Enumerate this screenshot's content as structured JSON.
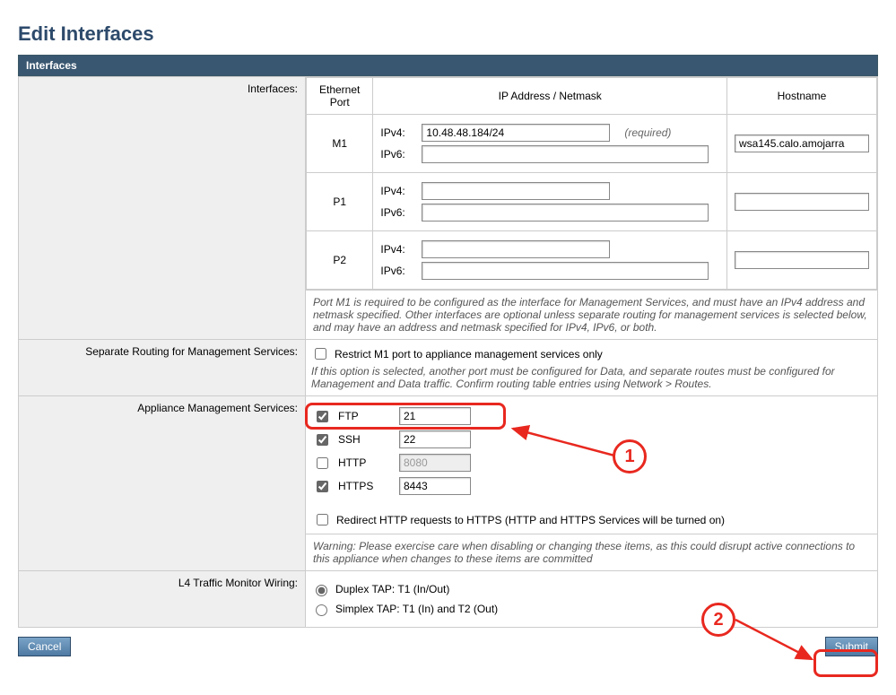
{
  "page": {
    "title": "Edit Interfaces",
    "section_header": "Interfaces"
  },
  "rows": {
    "interfaces_label": "Interfaces:",
    "routing_label": "Separate Routing for Management Services:",
    "services_label": "Appliance Management Services:",
    "l4_label": "L4 Traffic Monitor Wiring:"
  },
  "interfaces_table": {
    "headers": {
      "port": "Ethernet Port",
      "ip": "IP Address / Netmask",
      "host": "Hostname"
    },
    "ipv4_label": "IPv4:",
    "ipv6_label": "IPv6:",
    "required_text": "(required)",
    "rows": [
      {
        "port": "M1",
        "ipv4": "10.48.48.184/24",
        "ipv6": "",
        "host": "wsa145.calo.amojarra",
        "required": true
      },
      {
        "port": "P1",
        "ipv4": "",
        "ipv6": "",
        "host": "",
        "required": false
      },
      {
        "port": "P2",
        "ipv4": "",
        "ipv6": "",
        "host": "",
        "required": false
      }
    ],
    "footnote": "Port M1 is required to be configured as the interface for Management Services, and must have an IPv4 address and netmask specified. Other interfaces are optional unless separate routing for management services is selected below, and may have an address and netmask specified for IPv4, IPv6, or both."
  },
  "routing": {
    "checkbox_label": "Restrict M1 port to appliance management services only",
    "checked": false,
    "note": "If this option is selected, another port must be configured for Data, and separate routes must be configured for Management and Data traffic. Confirm routing table entries using Network > Routes."
  },
  "services": {
    "items": [
      {
        "name": "FTP",
        "checked": true,
        "port": "21",
        "disabled": false
      },
      {
        "name": "SSH",
        "checked": true,
        "port": "22",
        "disabled": false
      },
      {
        "name": "HTTP",
        "checked": false,
        "port": "8080",
        "disabled": true
      },
      {
        "name": "HTTPS",
        "checked": true,
        "port": "8443",
        "disabled": false
      }
    ],
    "redirect_label": "Redirect HTTP requests to HTTPS (HTTP and HTTPS Services will be turned on)",
    "redirect_checked": false,
    "warning": "Warning: Please exercise care when disabling or changing these items, as this could disrupt active connections to this appliance when changes to these items are committed"
  },
  "l4": {
    "options": [
      {
        "label": "Duplex TAP: T1 (In/Out)",
        "checked": true
      },
      {
        "label": "Simplex TAP: T1 (In) and T2 (Out)",
        "checked": false
      }
    ]
  },
  "buttons": {
    "cancel": "Cancel",
    "submit": "Submit"
  },
  "annotations": {
    "n1": "1",
    "n2": "2"
  }
}
